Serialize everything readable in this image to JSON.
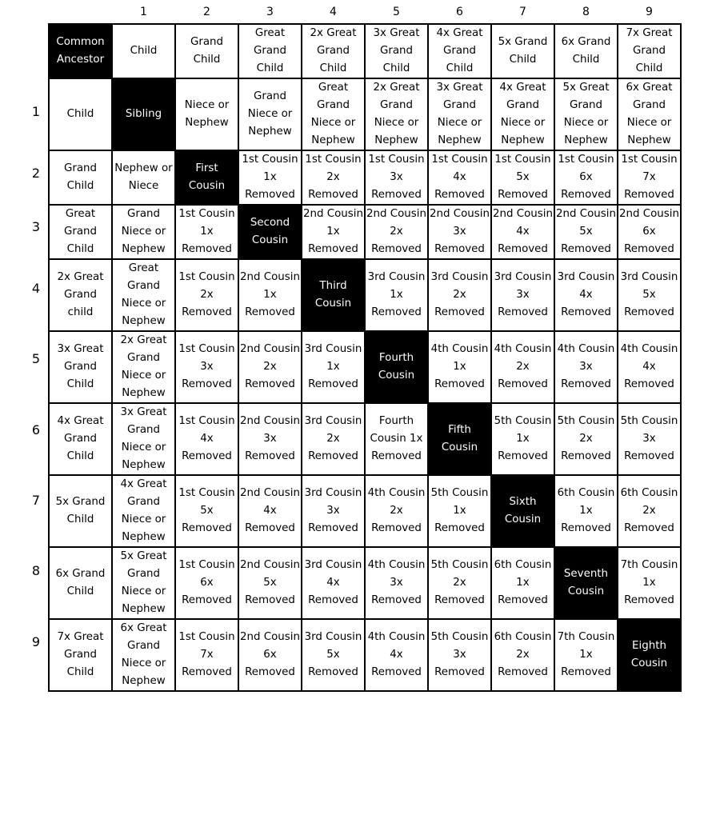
{
  "column_labels": [
    "1",
    "2",
    "3",
    "4",
    "5",
    "6",
    "7",
    "8",
    "9"
  ],
  "row_labels": [
    "1",
    "2",
    "3",
    "4",
    "5",
    "6",
    "7",
    "8",
    "9"
  ],
  "highlight_color": "#000000",
  "rows": [
    {
      "cells": [
        {
          "text": "Common\nAncestor",
          "highlight": true
        },
        {
          "text": "Child"
        },
        {
          "text": "Grand\nChild"
        },
        {
          "text": "Great\nGrand\nChild"
        },
        {
          "text": "2x Great\nGrand\nChild"
        },
        {
          "text": "3x Great\nGrand\nChild"
        },
        {
          "text": "4x Great\nGrand\nChild"
        },
        {
          "text": "5x Grand\nChild"
        },
        {
          "text": "6x Grand\nChild"
        },
        {
          "text": "7x Great\nGrand\nChild"
        }
      ]
    },
    {
      "cells": [
        {
          "text": "Child"
        },
        {
          "text": "Sibling",
          "highlight": true
        },
        {
          "text": "Niece or\nNephew"
        },
        {
          "text": "Grand\nNiece or\nNephew"
        },
        {
          "text": "Great\nGrand\nNiece or\nNephew"
        },
        {
          "text": "2x Great\nGrand\nNiece or\nNephew"
        },
        {
          "text": "3x Great\nGrand\nNiece or\nNephew"
        },
        {
          "text": "4x Great\nGrand\nNiece or\nNephew"
        },
        {
          "text": "5x Great\nGrand\nNiece or\nNephew"
        },
        {
          "text": "6x Great\nGrand\nNiece or\nNephew"
        }
      ]
    },
    {
      "cells": [
        {
          "text": "Grand\nChild"
        },
        {
          "text": "Nephew or\nNiece"
        },
        {
          "text": "First\nCousin",
          "highlight": true
        },
        {
          "text": "1st Cousin\n1x\nRemoved"
        },
        {
          "text": "1st Cousin\n2x\nRemoved"
        },
        {
          "text": "1st Cousin\n3x\nRemoved"
        },
        {
          "text": "1st Cousin\n4x\nRemoved"
        },
        {
          "text": "1st Cousin\n5x\nRemoved"
        },
        {
          "text": "1st Cousin\n6x\nRemoved"
        },
        {
          "text": "1st Cousin\n7x\nRemoved"
        }
      ]
    },
    {
      "cells": [
        {
          "text": "Great\nGrand\nChild"
        },
        {
          "text": "Grand\nNiece or\nNephew"
        },
        {
          "text": "1st Cousin\n1x\nRemoved"
        },
        {
          "text": "Second\nCousin",
          "highlight": true
        },
        {
          "text": "2nd Cousin\n1x\nRemoved"
        },
        {
          "text": "2nd Cousin\n2x\nRemoved"
        },
        {
          "text": "2nd Cousin\n3x\nRemoved"
        },
        {
          "text": "2nd Cousin\n4x\nRemoved"
        },
        {
          "text": "2nd Cousin\n5x\nRemoved"
        },
        {
          "text": "2nd Cousin\n6x\nRemoved"
        }
      ]
    },
    {
      "cells": [
        {
          "text": "2x Great\nGrand child"
        },
        {
          "text": "Great\nGrand\nNiece or\nNephew"
        },
        {
          "text": "1st Cousin\n2x\nRemoved"
        },
        {
          "text": "2nd Cousin\n1x\nRemoved"
        },
        {
          "text": "Third\nCousin",
          "highlight": true
        },
        {
          "text": "3rd Cousin\n1x\nRemoved"
        },
        {
          "text": "3rd Cousin\n2x\nRemoved"
        },
        {
          "text": "3rd Cousin\n3x\nRemoved"
        },
        {
          "text": "3rd Cousin\n4x\nRemoved"
        },
        {
          "text": "3rd Cousin\n5x\nRemoved"
        }
      ]
    },
    {
      "cells": [
        {
          "text": "3x Great\nGrand\nChild"
        },
        {
          "text": "2x Great\nGrand\nNiece or\nNephew"
        },
        {
          "text": "1st Cousin\n3x\nRemoved"
        },
        {
          "text": "2nd Cousin\n2x\nRemoved"
        },
        {
          "text": "3rd Cousin\n1x\nRemoved"
        },
        {
          "text": "Fourth\nCousin",
          "highlight": true
        },
        {
          "text": "4th Cousin\n1x\nRemoved"
        },
        {
          "text": "4th Cousin\n2x\nRemoved"
        },
        {
          "text": "4th Cousin\n3x\nRemoved"
        },
        {
          "text": "4th Cousin\n4x\nRemoved"
        }
      ]
    },
    {
      "cells": [
        {
          "text": "4x Great\nGrand\nChild"
        },
        {
          "text": "3x Great\nGrand\nNiece or\nNephew"
        },
        {
          "text": "1st Cousin\n4x\nRemoved"
        },
        {
          "text": "2nd Cousin\n3x\nRemoved"
        },
        {
          "text": "3rd Cousin\n2x\nRemoved"
        },
        {
          "text": "Fourth\nCousin 1x\nRemoved"
        },
        {
          "text": "Fifth\nCousin",
          "highlight": true
        },
        {
          "text": "5th Cousin\n1x\nRemoved"
        },
        {
          "text": "5th Cousin\n2x\nRemoved"
        },
        {
          "text": "5th Cousin\n3x\nRemoved"
        }
      ]
    },
    {
      "cells": [
        {
          "text": "5x Grand\nChild"
        },
        {
          "text": "4x Great\nGrand\nNiece or\nNephew"
        },
        {
          "text": "1st Cousin\n5x\nRemoved"
        },
        {
          "text": "2nd Cousin\n4x\nRemoved"
        },
        {
          "text": "3rd Cousin\n3x\nRemoved"
        },
        {
          "text": "4th Cousin\n2x\nRemoved"
        },
        {
          "text": "5th Cousin\n1x\nRemoved"
        },
        {
          "text": "Sixth\nCousin",
          "highlight": true
        },
        {
          "text": "6th Cousin\n1x\nRemoved"
        },
        {
          "text": "6th Cousin\n2x\nRemoved"
        }
      ]
    },
    {
      "cells": [
        {
          "text": "6x Grand\nChild"
        },
        {
          "text": "5x Great\nGrand\nNiece or\nNephew"
        },
        {
          "text": "1st Cousin\n6x\nRemoved"
        },
        {
          "text": "2nd Cousin\n5x\nRemoved"
        },
        {
          "text": "3rd Cousin\n4x\nRemoved"
        },
        {
          "text": "4th Cousin\n3x\nRemoved"
        },
        {
          "text": "5th Cousin\n2x\nRemoved"
        },
        {
          "text": "6th Cousin\n1x\nRemoved"
        },
        {
          "text": "Seventh\nCousin",
          "highlight": true
        },
        {
          "text": "7th Cousin\n1x\nRemoved"
        }
      ]
    },
    {
      "cells": [
        {
          "text": "7x Great\nGrand\nChild"
        },
        {
          "text": "6x Great\nGrand\nNiece or\nNephew"
        },
        {
          "text": "1st Cousin\n7x\nRemoved"
        },
        {
          "text": "2nd Cousin\n6x\nRemoved"
        },
        {
          "text": "3rd Cousin\n5x\nRemoved"
        },
        {
          "text": "4th Cousin\n4x\nRemoved"
        },
        {
          "text": "5th Cousin\n3x\nRemoved"
        },
        {
          "text": "6th Cousin\n2x\nRemoved"
        },
        {
          "text": "7th Cousin\n1x\nRemoved"
        },
        {
          "text": "Eighth\nCousin",
          "highlight": true
        }
      ]
    }
  ]
}
